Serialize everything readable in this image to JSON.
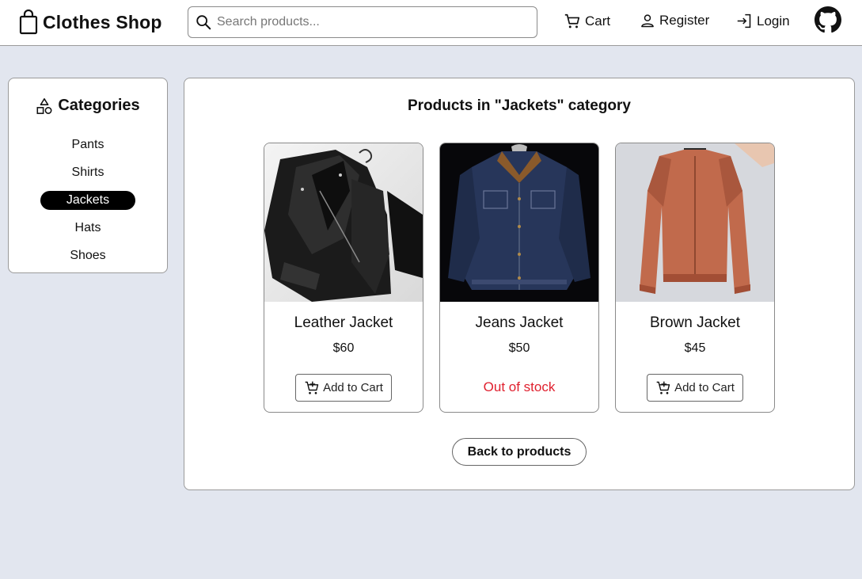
{
  "header": {
    "brand": "Clothes Shop",
    "brand_icon": "shopping-bag-icon",
    "search": {
      "placeholder": "Search products...",
      "value": ""
    },
    "nav": {
      "cart": "Cart",
      "register": "Register",
      "login": "Login"
    },
    "github_icon": "github-icon"
  },
  "sidebar": {
    "title": "Categories",
    "icon": "shapes-icon",
    "items": [
      {
        "label": "Pants",
        "active": false
      },
      {
        "label": "Shirts",
        "active": false
      },
      {
        "label": "Jackets",
        "active": true
      },
      {
        "label": "Hats",
        "active": false
      },
      {
        "label": "Shoes",
        "active": false
      }
    ]
  },
  "main": {
    "title": "Products in \"Jackets\" category",
    "products": [
      {
        "name": "Leather Jacket",
        "price": "$60",
        "action": "Add to Cart",
        "in_stock": true
      },
      {
        "name": "Jeans Jacket",
        "price": "$50",
        "status": "Out of stock",
        "in_stock": false
      },
      {
        "name": "Brown Jacket",
        "price": "$45",
        "action": "Add to Cart",
        "in_stock": true
      }
    ],
    "back_label": "Back to products"
  },
  "colors": {
    "page_bg": "#e2e6ef",
    "active_category_bg": "#000000",
    "out_of_stock": "#e0202e"
  }
}
